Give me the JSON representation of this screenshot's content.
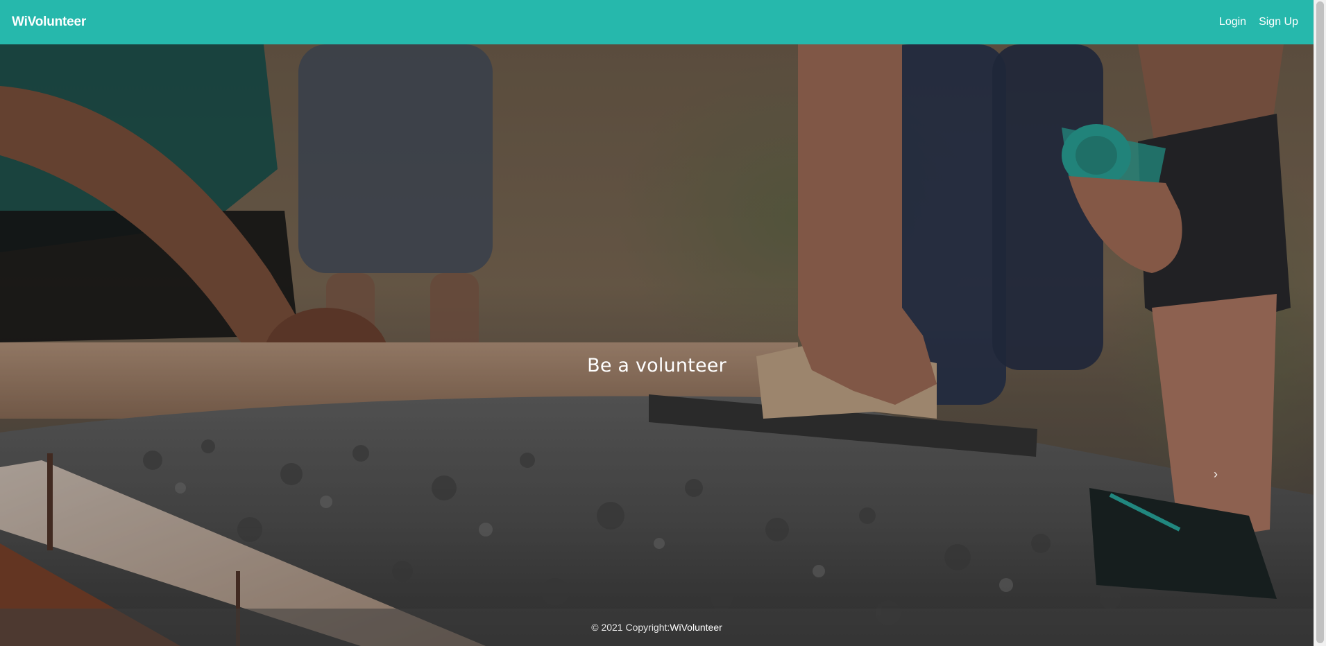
{
  "navbar": {
    "brand": "WiVolunteer",
    "links": [
      {
        "label": "Login"
      },
      {
        "label": "Sign Up"
      }
    ],
    "color": "#26b8ac"
  },
  "hero": {
    "title": "Be a volunteer",
    "next_icon": "chevron-right-icon",
    "next_glyph": "›"
  },
  "footer": {
    "copyright": "© 2021 Copyright:",
    "brand": "WiVolunteer"
  }
}
